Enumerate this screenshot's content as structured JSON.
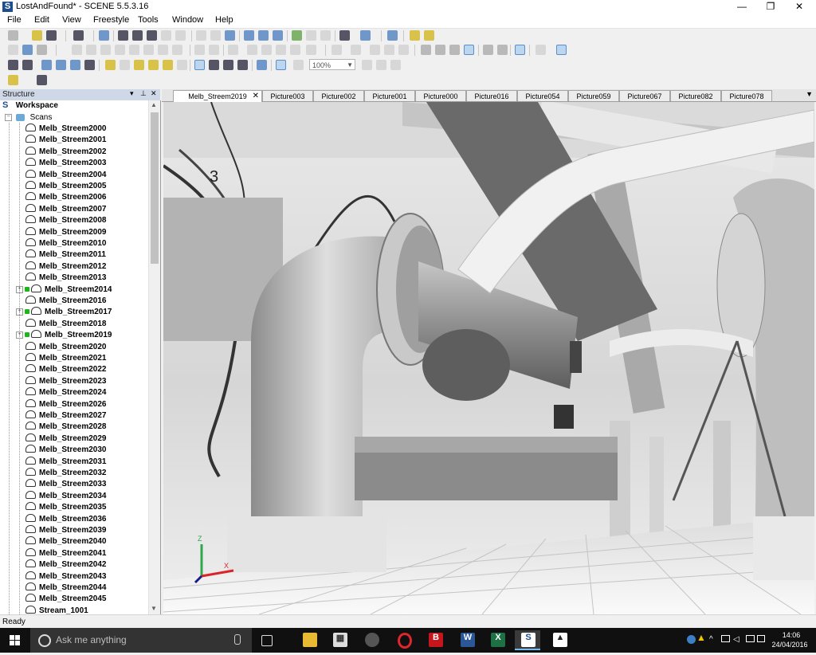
{
  "window": {
    "title": "LostAndFound* - SCENE 5.5.3.16",
    "app_glyph": "S",
    "minimize": "—",
    "maximize": "❐",
    "close": "✕"
  },
  "menu": [
    "File",
    "Edit",
    "View",
    "Freestyle",
    "Tools",
    "Window",
    "Help"
  ],
  "toolbar": {
    "zoom_value": "100%"
  },
  "structure": {
    "title": "Structure",
    "workspace_label": "Workspace",
    "scans_label": "Scans",
    "items": [
      {
        "label": "Melb_Streem2000",
        "expandable": false
      },
      {
        "label": "Melb_Streem2001",
        "expandable": false
      },
      {
        "label": "Melb_Streem2002",
        "expandable": false
      },
      {
        "label": "Melb_Streem2003",
        "expandable": false
      },
      {
        "label": "Melb_Streem2004",
        "expandable": false
      },
      {
        "label": "Melb_Streem2005",
        "expandable": false
      },
      {
        "label": "Melb_Streem2006",
        "expandable": false
      },
      {
        "label": "Melb_Streem2007",
        "expandable": false
      },
      {
        "label": "Melb_Streem2008",
        "expandable": false
      },
      {
        "label": "Melb_Streem2009",
        "expandable": false
      },
      {
        "label": "Melb_Streem2010",
        "expandable": false
      },
      {
        "label": "Melb_Streem2011",
        "expandable": false
      },
      {
        "label": "Melb_Streem2012",
        "expandable": false
      },
      {
        "label": "Melb_Streem2013",
        "expandable": false
      },
      {
        "label": "Melb_Streem2014",
        "expandable": true
      },
      {
        "label": "Melb_Streem2016",
        "expandable": false
      },
      {
        "label": "Melb_Streem2017",
        "expandable": true
      },
      {
        "label": "Melb_Streem2018",
        "expandable": false
      },
      {
        "label": "Melb_Streem2019",
        "expandable": true
      },
      {
        "label": "Melb_Streem2020",
        "expandable": false
      },
      {
        "label": "Melb_Streem2021",
        "expandable": false
      },
      {
        "label": "Melb_Streem2022",
        "expandable": false
      },
      {
        "label": "Melb_Streem2023",
        "expandable": false
      },
      {
        "label": "Melb_Streem2024",
        "expandable": false
      },
      {
        "label": "Melb_Streem2026",
        "expandable": false
      },
      {
        "label": "Melb_Streem2027",
        "expandable": false
      },
      {
        "label": "Melb_Streem2028",
        "expandable": false
      },
      {
        "label": "Melb_Streem2029",
        "expandable": false
      },
      {
        "label": "Melb_Streem2030",
        "expandable": false
      },
      {
        "label": "Melb_Streem2031",
        "expandable": false
      },
      {
        "label": "Melb_Streem2032",
        "expandable": false
      },
      {
        "label": "Melb_Streem2033",
        "expandable": false
      },
      {
        "label": "Melb_Streem2034",
        "expandable": false
      },
      {
        "label": "Melb_Streem2035",
        "expandable": false
      },
      {
        "label": "Melb_Streem2036",
        "expandable": false
      },
      {
        "label": "Melb_Streem2039",
        "expandable": false
      },
      {
        "label": "Melb_Streem2040",
        "expandable": false
      },
      {
        "label": "Melb_Streem2041",
        "expandable": false
      },
      {
        "label": "Melb_Streem2042",
        "expandable": false
      },
      {
        "label": "Melb_Streem2043",
        "expandable": false
      },
      {
        "label": "Melb_Streem2044",
        "expandable": false
      },
      {
        "label": "Melb_Streem2045",
        "expandable": false
      },
      {
        "label": "Stream_1001",
        "expandable": false
      }
    ]
  },
  "tabs": [
    {
      "label": "Melb_Streem2019",
      "active": true
    },
    {
      "label": "Picture003",
      "active": false
    },
    {
      "label": "Picture002",
      "active": false
    },
    {
      "label": "Picture001",
      "active": false
    },
    {
      "label": "Picture000",
      "active": false
    },
    {
      "label": "Picture016",
      "active": false
    },
    {
      "label": "Picture054",
      "active": false
    },
    {
      "label": "Picture059",
      "active": false
    },
    {
      "label": "Picture067",
      "active": false
    },
    {
      "label": "Picture082",
      "active": false
    },
    {
      "label": "Picture078",
      "active": false
    }
  ],
  "viewport": {
    "label_on_pipe": "3",
    "axis_z": "Z",
    "axis_x": "X"
  },
  "status": "Ready",
  "taskbar": {
    "search_placeholder": "Ask me anything",
    "time": "14:06",
    "date": "24/04/2016"
  },
  "colors": {
    "accent": "#76b9ed",
    "tree_node_status": "#18b818",
    "axis_z": "#2ea84a",
    "axis_x": "#d9252a"
  }
}
